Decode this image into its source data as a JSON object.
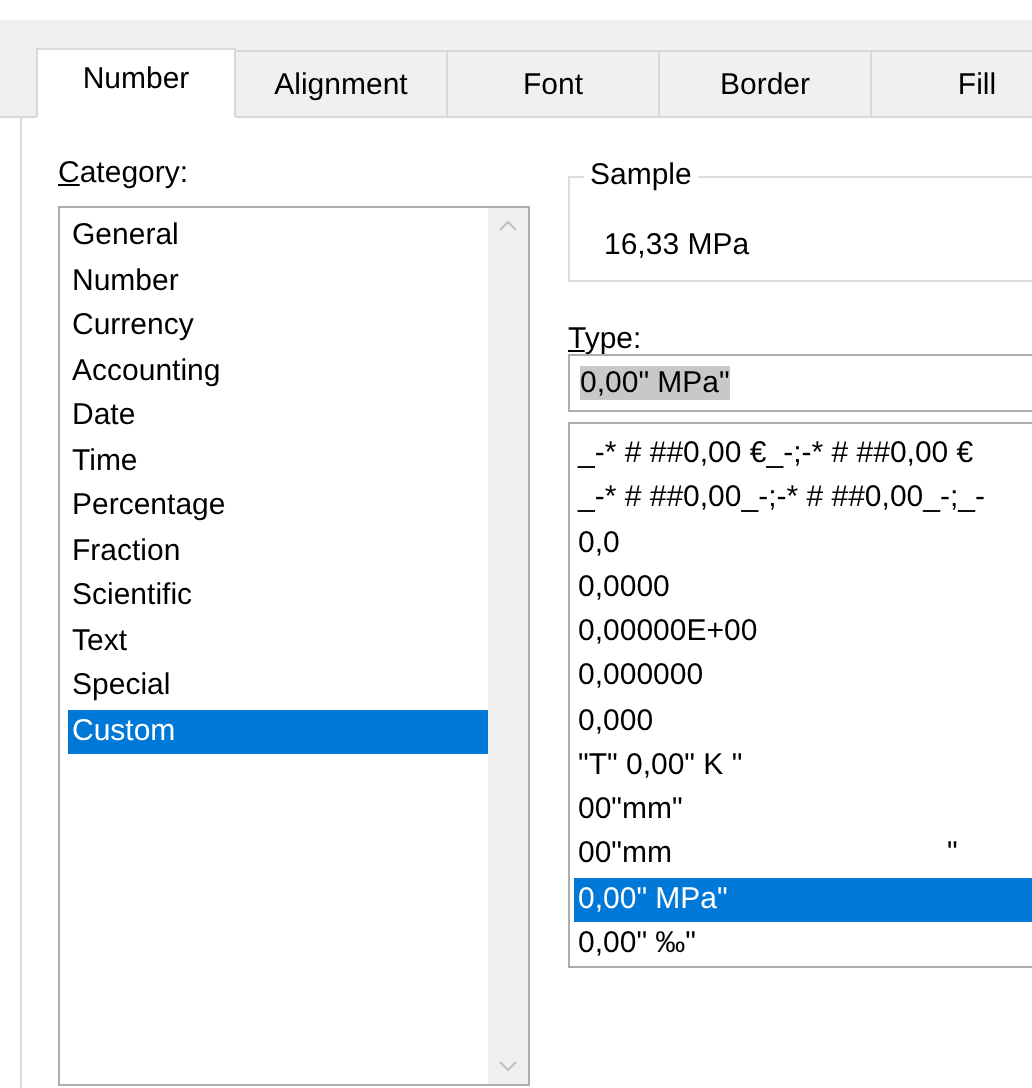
{
  "tabs": [
    {
      "label": "Number",
      "selected": true
    },
    {
      "label": "Alignment",
      "selected": false
    },
    {
      "label": "Font",
      "selected": false
    },
    {
      "label": "Border",
      "selected": false
    },
    {
      "label": "Fill",
      "selected": false
    }
  ],
  "category": {
    "label": "Category:",
    "items": [
      {
        "label": "General",
        "selected": false
      },
      {
        "label": "Number",
        "selected": false
      },
      {
        "label": "Currency",
        "selected": false
      },
      {
        "label": "Accounting",
        "selected": false
      },
      {
        "label": "Date",
        "selected": false
      },
      {
        "label": "Time",
        "selected": false
      },
      {
        "label": "Percentage",
        "selected": false
      },
      {
        "label": "Fraction",
        "selected": false
      },
      {
        "label": "Scientific",
        "selected": false
      },
      {
        "label": "Text",
        "selected": false
      },
      {
        "label": "Special",
        "selected": false
      },
      {
        "label": "Custom",
        "selected": true
      }
    ]
  },
  "sample": {
    "label": "Sample",
    "value": "16,33 MPa"
  },
  "type": {
    "label": "Type:",
    "value": "0,00\" MPa\"",
    "formats": [
      {
        "label": "_-* # ##0,00 €_-;-* # ##0,00 €",
        "selected": false
      },
      {
        "label": "_-* # ##0,00_-;-* # ##0,00_-;_-",
        "selected": false
      },
      {
        "label": "0,0",
        "selected": false
      },
      {
        "label": "0,0000",
        "selected": false
      },
      {
        "label": "0,00000E+00",
        "selected": false
      },
      {
        "label": "0,000000",
        "selected": false
      },
      {
        "label": "0,000",
        "selected": false
      },
      {
        "label": "\"T\" 0,00\" K \"",
        "selected": false
      },
      {
        "label": "00\"mm\"",
        "selected": false
      },
      {
        "label": "00\"mm                                 \"",
        "selected": false
      },
      {
        "label": "0,00\" MPa\"",
        "selected": true
      },
      {
        "label": "0,00\" ‰\"",
        "selected": false
      }
    ]
  }
}
